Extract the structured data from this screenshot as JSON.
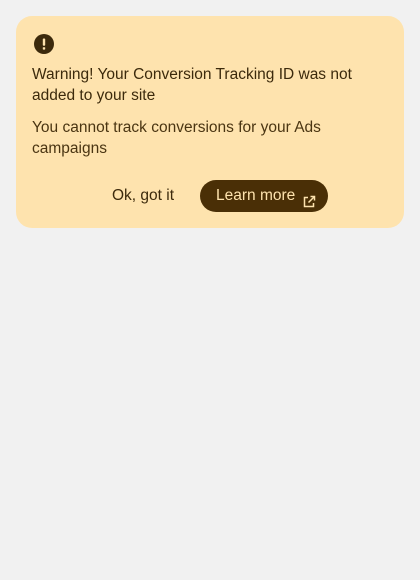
{
  "alert": {
    "icon": "error-icon",
    "title": "Warning! Your Conversion Tracking ID was not added to your site",
    "description": "You cannot track conversions for your Ads campaigns",
    "dismiss_label": "Ok, got it",
    "learn_more_label": "Learn more",
    "learn_more_icon": "open-in-new-icon"
  },
  "colors": {
    "page_background": "#f1f1f1",
    "card_background": "#fee3ae",
    "text": "#3c2a0c",
    "button_fill": "#4a2f06"
  }
}
